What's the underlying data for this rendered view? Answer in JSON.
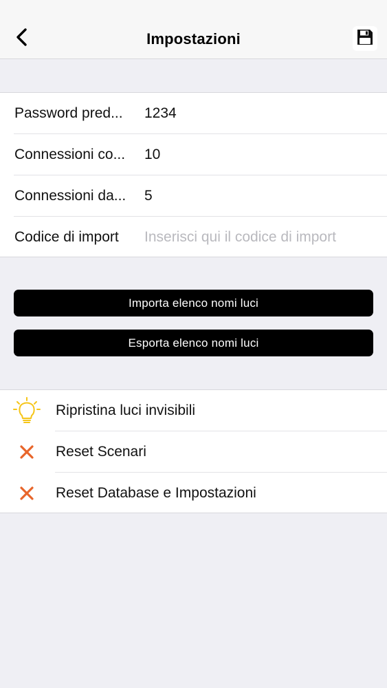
{
  "nav": {
    "title": "Impostazioni",
    "back_icon": "chevron-left-icon",
    "save_icon": "floppy-disk-icon"
  },
  "settings": [
    {
      "label": "Password pred...",
      "value": "1234",
      "placeholder": ""
    },
    {
      "label": "Connessioni co...",
      "value": "10",
      "placeholder": ""
    },
    {
      "label": "Connessioni da...",
      "value": "5",
      "placeholder": ""
    },
    {
      "label": "Codice di import",
      "value": "",
      "placeholder": "Inserisci qui il codice di import"
    }
  ],
  "buttons": {
    "import_label": "Importa elenco nomi luci",
    "export_label": "Esporta elenco nomi luci"
  },
  "actions": [
    {
      "label": "Ripristina luci invisibili",
      "icon": "lightbulb-icon",
      "color": "#f5c518"
    },
    {
      "label": "Reset Scenari",
      "icon": "close-icon",
      "color": "#e8652a"
    },
    {
      "label": "Reset Database e Impostazioni",
      "icon": "close-icon",
      "color": "#e8652a"
    }
  ]
}
